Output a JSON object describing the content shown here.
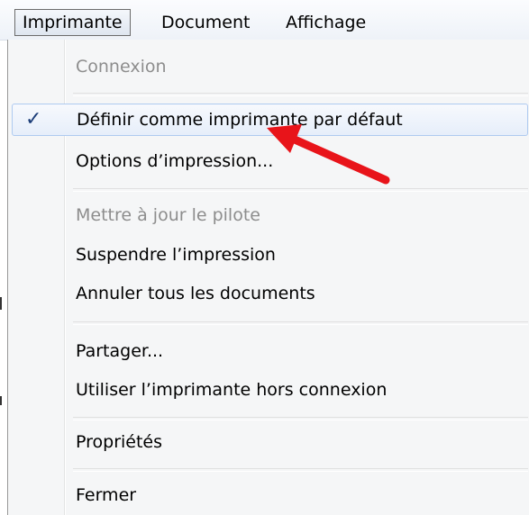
{
  "menubar": {
    "items": [
      "Imprimante",
      "Document",
      "Affichage"
    ]
  },
  "menu": {
    "connexion": "Connexion",
    "set_default": "Définir comme imprimante par défaut",
    "print_options": "Options d’impression...",
    "update_driver": "Mettre à jour le pilote",
    "pause_printing": "Suspendre l’impression",
    "cancel_all": "Annuler tous les documents",
    "share": "Partager...",
    "use_offline": "Utiliser l’imprimante hors connexion",
    "properties": "Propriétés",
    "close": "Fermer"
  },
  "check_icon": "checkmark-icon",
  "annotation": {
    "arrow_color": "#e8141a"
  }
}
